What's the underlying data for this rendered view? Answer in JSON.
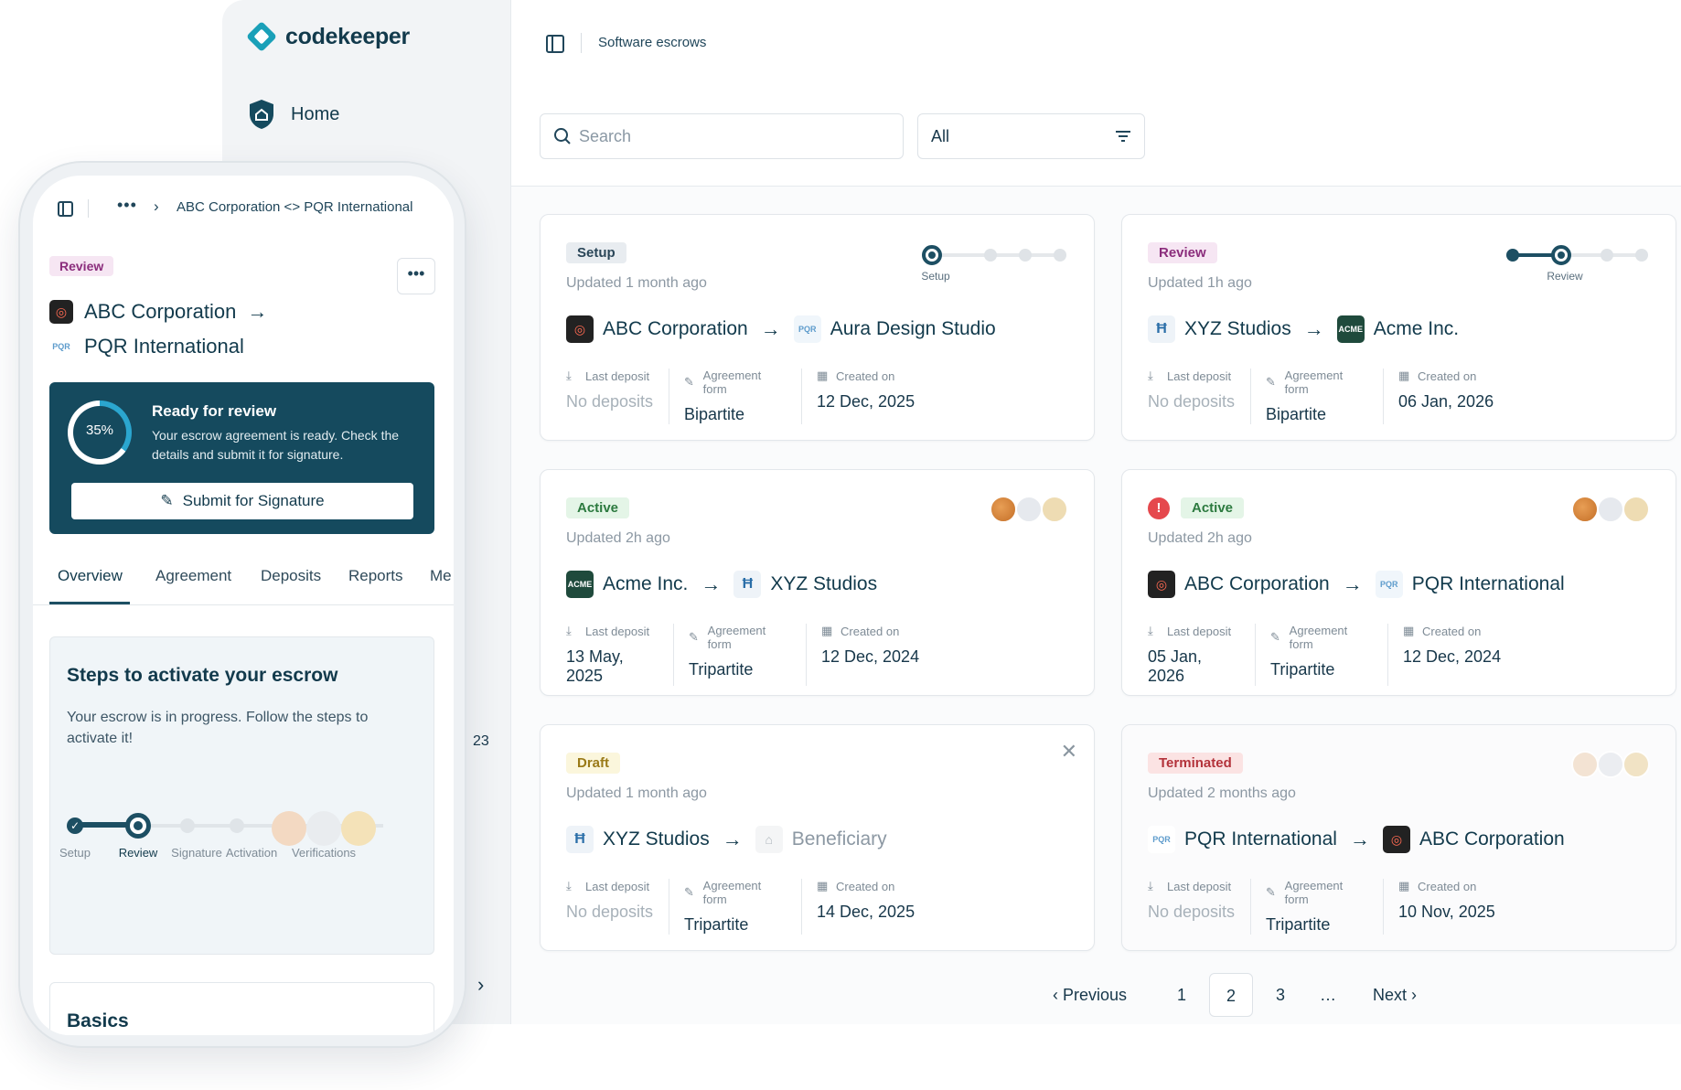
{
  "app": {
    "brand": "codekeeper",
    "brand_color": "#1aa0b8",
    "primary_color": "#154a5e"
  },
  "sidebar": {
    "items": [
      {
        "label": "Home",
        "icon": "home-icon"
      }
    ]
  },
  "header": {
    "breadcrumb": "Software escrows"
  },
  "toolbar": {
    "search_placeholder": "Search",
    "filter_value": "All"
  },
  "cards": [
    {
      "status": "Setup",
      "updated": "Updated 1 month ago",
      "from": "ABC Corporation",
      "to": "Aura Design Studio",
      "from_logo": "abc",
      "to_logo": "pqr",
      "stepper": {
        "current": "Setup",
        "step_index": 0,
        "steps": 4
      },
      "last_deposit_label": "Last deposit",
      "last_deposit": "No deposits",
      "agreement_label": "Agreement form",
      "agreement": "Bipartite",
      "created_label": "Created on",
      "created": "12 Dec, 2025"
    },
    {
      "status": "Review",
      "updated": "Updated 1h ago",
      "from": "XYZ Studios",
      "to": "Acme Inc.",
      "from_logo": "xyz",
      "to_logo": "acme",
      "stepper": {
        "current": "Review",
        "step_index": 1,
        "steps": 4
      },
      "last_deposit_label": "Last deposit",
      "last_deposit": "No deposits",
      "agreement_label": "Agreement form",
      "agreement": "Bipartite",
      "created_label": "Created on",
      "created": "06 Jan, 2026"
    },
    {
      "status": "Active",
      "updated": "Updated 2h ago",
      "from": "Acme Inc.",
      "to": "XYZ Studios",
      "from_logo": "acme",
      "to_logo": "xyz",
      "last_deposit_label": "Last deposit",
      "last_deposit": "13 May, 2025",
      "agreement_label": "Agreement form",
      "agreement": "Tripartite",
      "created_label": "Created on",
      "created": "12 Dec, 2024"
    },
    {
      "status": "Active",
      "updated": "Updated 2h ago",
      "alert": "!",
      "from": "ABC Corporation",
      "to": "PQR International",
      "from_logo": "abc",
      "to_logo": "pqr",
      "last_deposit_label": "Last deposit",
      "last_deposit": "05 Jan, 2026",
      "agreement_label": "Agreement form",
      "agreement": "Tripartite",
      "created_label": "Created on",
      "created": "12 Dec, 2024"
    },
    {
      "status": "Draft",
      "updated": "Updated 1 month ago",
      "from": "XYZ Studios",
      "to": "Beneficiary",
      "from_logo": "xyz",
      "to_logo": "beneficiary",
      "last_deposit_label": "Last deposit",
      "last_deposit": "No deposits",
      "agreement_label": "Agreement form",
      "agreement": "Tripartite",
      "created_label": "Created on",
      "created": "14 Dec, 2025"
    },
    {
      "status": "Terminated",
      "updated": "Updated 2 months ago",
      "from": "PQR International",
      "to": "ABC Corporation",
      "from_logo": "pqr",
      "to_logo": "abc",
      "last_deposit_label": "Last deposit",
      "last_deposit": "No deposits",
      "agreement_label": "Agreement form",
      "agreement": "Tripartite",
      "created_label": "Created on",
      "created": "10 Nov, 2025"
    }
  ],
  "logos": {
    "acme": "ACME",
    "pqr": "PQR",
    "xyz": "Ħ"
  },
  "pagination": {
    "previous": "Previous",
    "pages": [
      "1",
      "2",
      "3"
    ],
    "current": "2",
    "ellipsis": "…",
    "next": "Next"
  },
  "side": {
    "count": "23"
  },
  "mobile": {
    "breadcrumb": "ABC Corporation <> PQR International",
    "status": "Review",
    "from": "ABC Corporation",
    "to": "PQR International",
    "ready": {
      "progress": "35%",
      "progress_value": 0.35,
      "title": "Ready for review",
      "text": "Your escrow agreement is ready. Check the details and submit it for signature.",
      "button": "Submit for Signature"
    },
    "tabs": [
      "Overview",
      "Agreement",
      "Deposits",
      "Reports",
      "Me"
    ],
    "active_tab": "Overview",
    "steps": {
      "title": "Steps to activate your escrow",
      "text": "Your escrow is in progress. Follow the steps to activate it!",
      "labels": [
        "Setup",
        "Review",
        "Signature",
        "Activation",
        "Verifications"
      ],
      "current": "Review"
    },
    "basics_title": "Basics"
  }
}
